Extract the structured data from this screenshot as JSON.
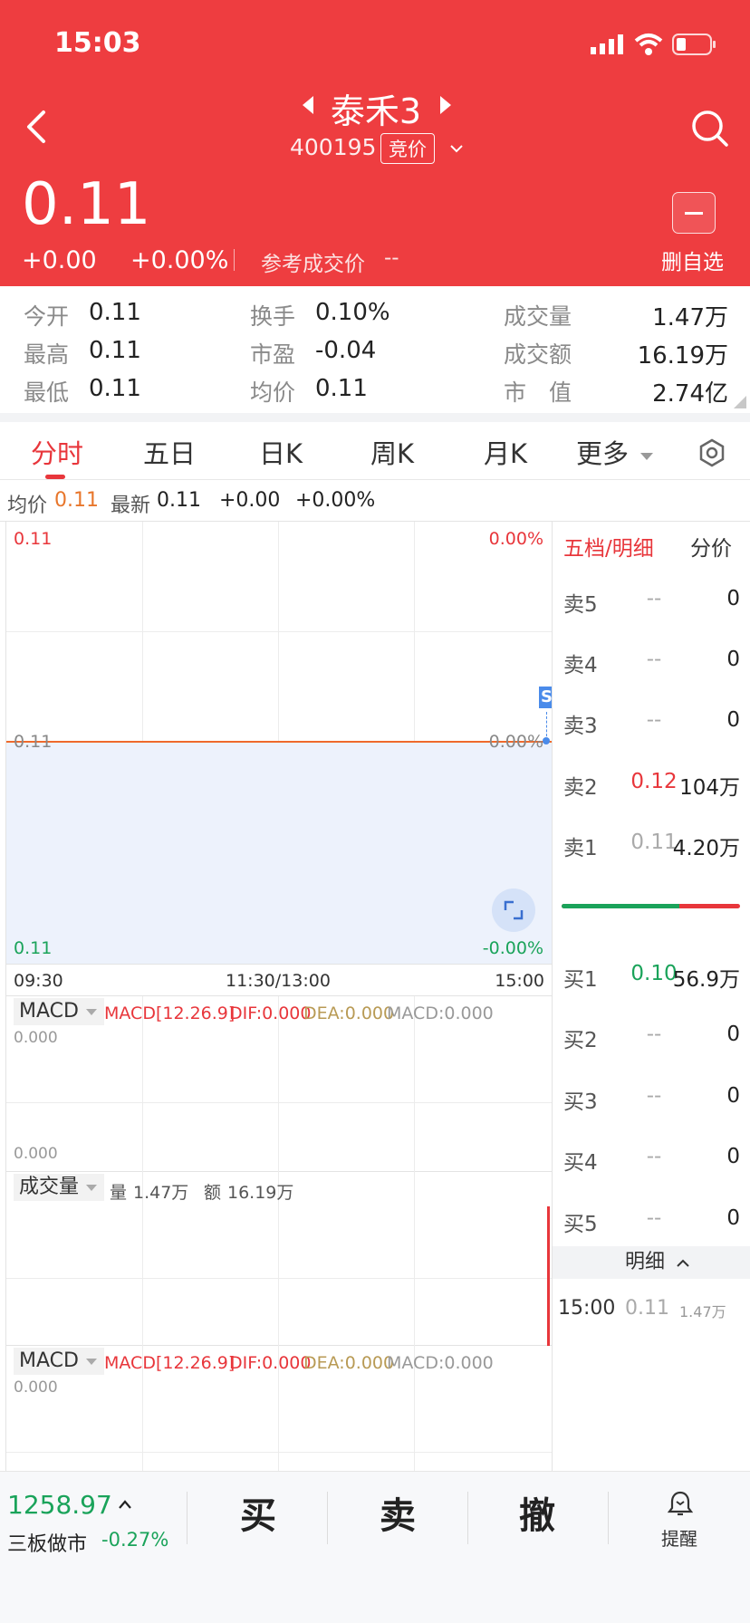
{
  "status_bar": {
    "time": "15:03"
  },
  "header": {
    "title": "泰禾3",
    "code": "400195",
    "tag": "竞价",
    "price": "0.11",
    "change": "+0.00",
    "change_pct": "+0.00%",
    "ref_label": "参考成交价",
    "ref_value": "--",
    "watch_label": "删自选"
  },
  "stats": {
    "open_label": "今开",
    "open": "0.11",
    "high_label": "最高",
    "high": "0.11",
    "low_label": "最低",
    "low": "0.11",
    "turnover_label": "换手",
    "turnover": "0.10%",
    "pe_label": "市盈",
    "pe": "-0.04",
    "avg_label": "均价",
    "avg": "0.11",
    "volume_label": "成交量",
    "volume": "1.47万",
    "amount_label": "成交额",
    "amount": "16.19万",
    "mcap_label": "市　值",
    "mcap": "2.74亿"
  },
  "tabs": [
    "分时",
    "五日",
    "日K",
    "周K",
    "月K",
    "更多"
  ],
  "info_line": {
    "avg_label": "均价",
    "avg": "0.11",
    "latest_label": "最新",
    "latest": "0.11",
    "change": "+0.00",
    "change_pct": "+0.00%"
  },
  "chart": {
    "top_left": "0.11",
    "top_right": "0.00%",
    "mid_left": "0.11",
    "mid_right": "0.00%",
    "bot_left": "0.11",
    "bot_right": "-0.00%",
    "t_start": "09:30",
    "t_mid": "11:30/13:00",
    "t_end": "15:00",
    "marker": "S"
  },
  "macd1": {
    "selector": "MACD",
    "params": "MACD[12.26.9]",
    "dif": "DIF:0.000",
    "dea": "DEA:0.000",
    "macd": "MACD:0.000",
    "top": "0.000",
    "bottom": "0.000"
  },
  "volume": {
    "selector": "成交量",
    "vol_label": "量",
    "vol": "1.47万",
    "amt_label": "额",
    "amt": "16.19万"
  },
  "macd2": {
    "selector": "MACD",
    "params": "MACD[12.26.9]",
    "dif": "DIF:0.000",
    "dea": "DEA:0.000",
    "macd": "MACD:0.000",
    "top": "0.000"
  },
  "orderbook": {
    "tab_active": "五档/明细",
    "tab_other": "分价",
    "asks": [
      {
        "label": "卖5",
        "price": "--",
        "vol": "0"
      },
      {
        "label": "卖4",
        "price": "--",
        "vol": "0"
      },
      {
        "label": "卖3",
        "price": "--",
        "vol": "0"
      },
      {
        "label": "卖2",
        "price": "0.12",
        "vol": "104万"
      },
      {
        "label": "卖1",
        "price": "0.11",
        "vol": "4.20万"
      }
    ],
    "bids": [
      {
        "label": "买1",
        "price": "0.10",
        "vol": "56.9万"
      },
      {
        "label": "买2",
        "price": "--",
        "vol": "0"
      },
      {
        "label": "买3",
        "price": "--",
        "vol": "0"
      },
      {
        "label": "买4",
        "price": "--",
        "vol": "0"
      },
      {
        "label": "买5",
        "price": "--",
        "vol": "0"
      }
    ],
    "buy_share": 0.66,
    "detail_label": "明细",
    "detail": {
      "time": "15:00",
      "price": "0.11",
      "vol": "1.47万"
    }
  },
  "bottom_bar": {
    "index_value": "1258.97",
    "index_name": "三板做市",
    "index_change": "-0.27%",
    "buy": "买",
    "sell": "卖",
    "cancel": "撤",
    "alert": "提醒"
  },
  "colors": {
    "red": "#ee3d40",
    "green": "#1aa35a",
    "orange": "#e8762b",
    "blue": "#4a8bea"
  }
}
